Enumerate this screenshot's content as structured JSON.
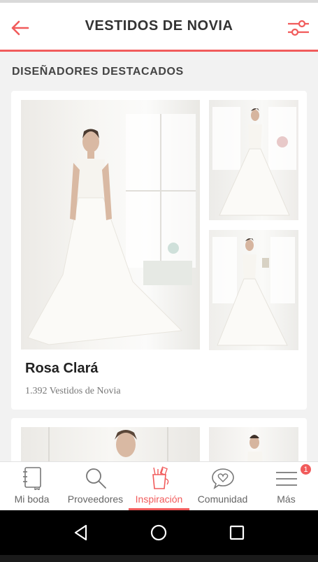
{
  "header": {
    "title": "VESTIDOS DE NOVIA"
  },
  "section": {
    "title": "DISEÑADORES DESTACADOS"
  },
  "cards": [
    {
      "designer": "Rosa Clará",
      "count": "1.392 Vestidos de Novia"
    }
  ],
  "nav": {
    "items": [
      {
        "label": "Mi boda",
        "icon": "notebook-icon"
      },
      {
        "label": "Proveedores",
        "icon": "search-icon"
      },
      {
        "label": "Inspiración",
        "icon": "inspiration-icon",
        "active": true
      },
      {
        "label": "Comunidad",
        "icon": "chat-heart-icon"
      },
      {
        "label": "Más",
        "icon": "menu-icon",
        "badge": "1"
      }
    ]
  },
  "colors": {
    "accent": "#f15b5b",
    "background": "#f2f2f2"
  }
}
